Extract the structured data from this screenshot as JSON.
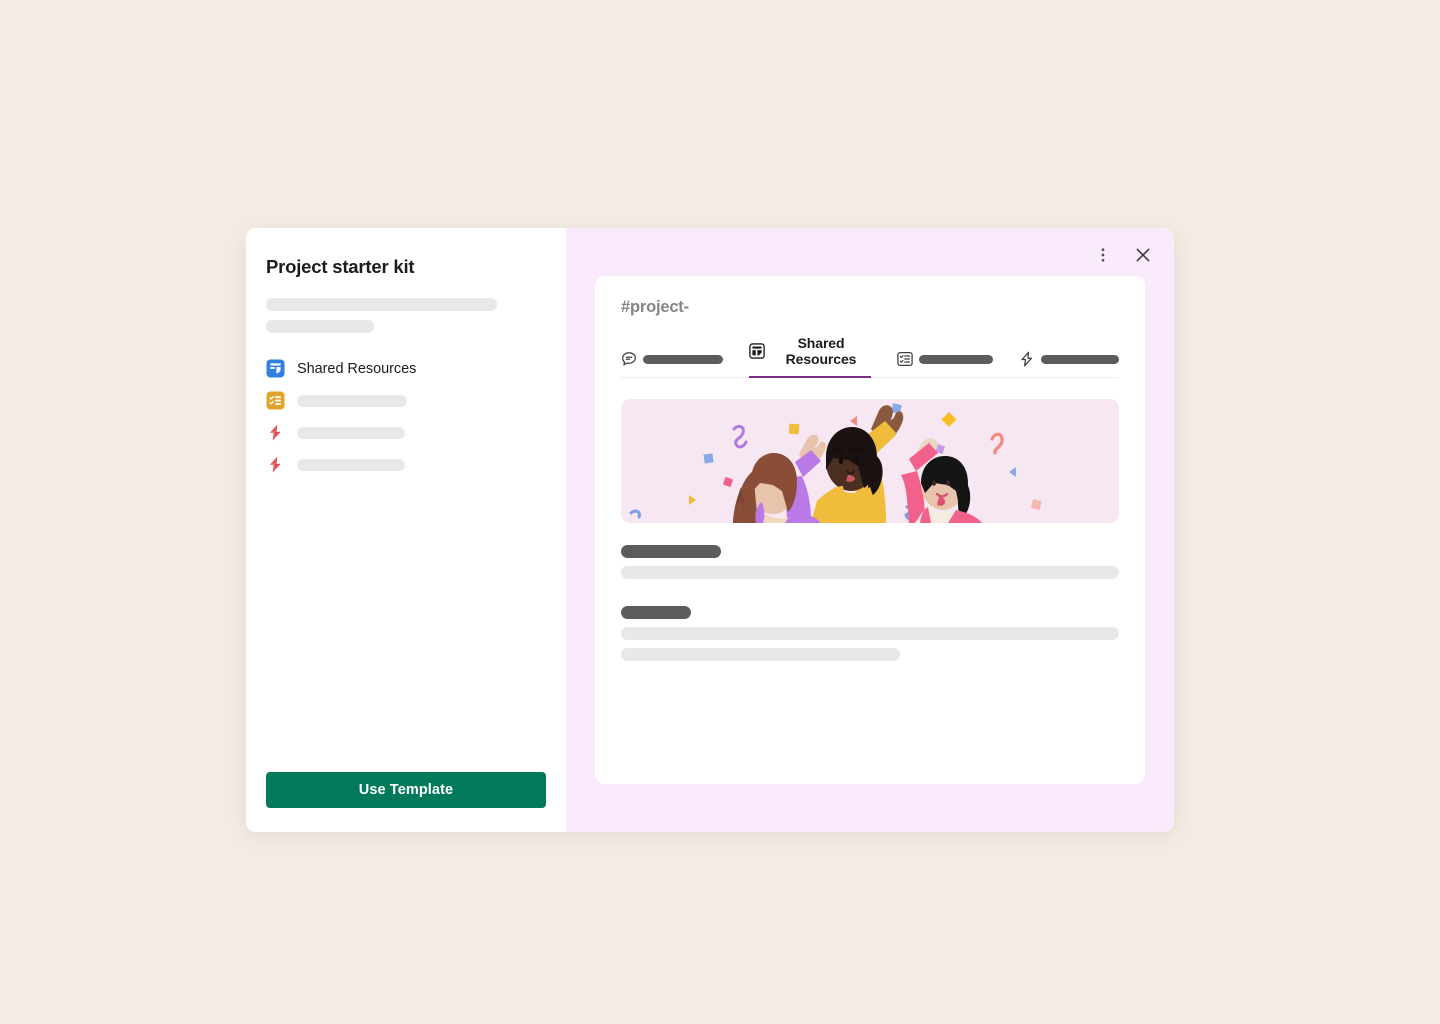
{
  "page": {
    "background_color": "#f4ece4"
  },
  "modal": {
    "left_panel": {
      "title": "Project starter kit",
      "description_placeholders": [
        {
          "name": "description-line-1"
        },
        {
          "name": "description-line-2"
        }
      ],
      "resources": [
        {
          "icon": "canvas-icon",
          "icon_color": "#2f80e0",
          "label": "Shared Resources",
          "has_label": true
        },
        {
          "icon": "list-icon",
          "icon_color": "#e0a32a",
          "label": "",
          "has_label": false
        },
        {
          "icon": "workflow-bolt-icon",
          "icon_color": "#ef5b5b",
          "label": "",
          "has_label": false
        },
        {
          "icon": "workflow-bolt-icon",
          "icon_color": "#ef5b5b",
          "label": "",
          "has_label": false
        }
      ],
      "primary_button": {
        "label": "Use Template",
        "color": "#007a5a"
      }
    },
    "right_panel": {
      "background_color": "#f9ebfb",
      "window_actions": [
        {
          "name": "more-options-icon",
          "label": "More options"
        },
        {
          "name": "close-icon",
          "label": "Close"
        }
      ],
      "preview": {
        "channel_name": "#project-",
        "active_tab_underline_color": "#7c3085",
        "tabs": [
          {
            "icon": "messages-icon",
            "label": "",
            "has_label": false,
            "active": false
          },
          {
            "icon": "canvas-icon",
            "label": "Shared Resources",
            "has_label": true,
            "active": true
          },
          {
            "icon": "list-icon",
            "label": "",
            "has_label": false,
            "active": false
          },
          {
            "icon": "workflow-bolt-icon",
            "label": "",
            "has_label": false,
            "active": false
          }
        ],
        "hero_image": {
          "name": "celebration-illustration",
          "description": "Three people high-fiving with confetti",
          "background_color": "#f6e7f3"
        },
        "content_placeholders": [
          {
            "name": "heading-1",
            "tone": "dark"
          },
          {
            "name": "paragraph-1",
            "tone": "light"
          },
          {
            "name": "heading-2",
            "tone": "dark"
          },
          {
            "name": "paragraph-2",
            "tone": "light"
          },
          {
            "name": "paragraph-3",
            "tone": "light"
          }
        ]
      }
    }
  }
}
